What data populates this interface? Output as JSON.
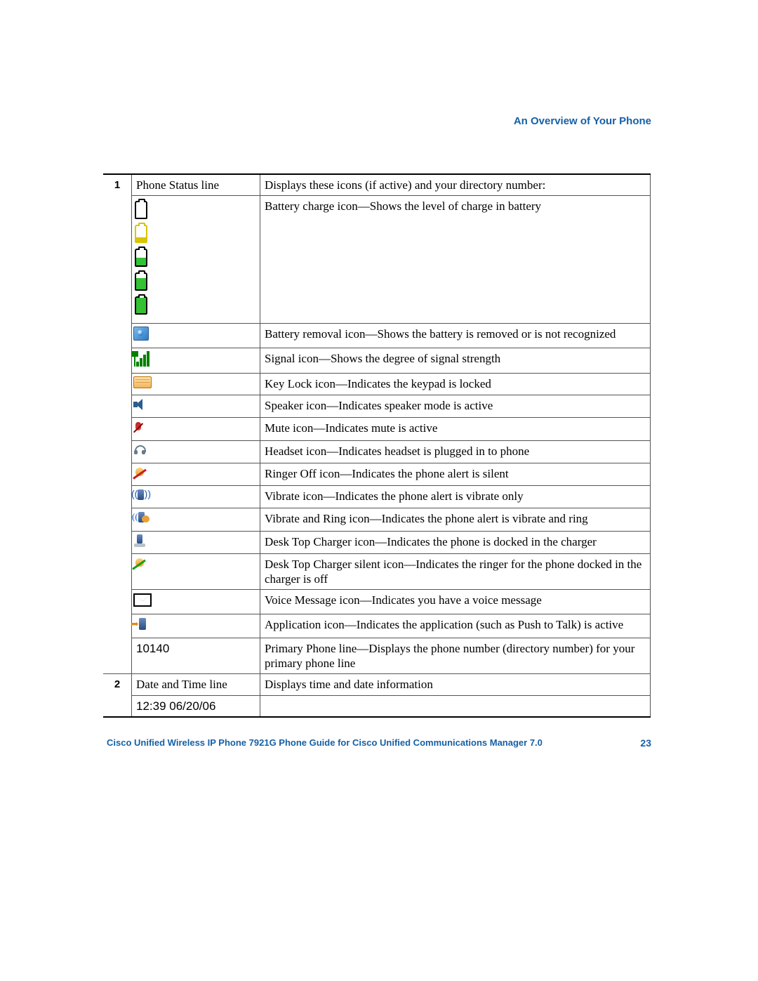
{
  "header": {
    "section_title": "An Overview of Your Phone"
  },
  "table": {
    "row1": {
      "num": "1",
      "label": "Phone Status line",
      "desc_top": "Displays these icons (if active) and your directory number:",
      "battery_desc": "Battery charge icon—Shows the level of charge in battery",
      "battery_removal": "Battery removal icon—Shows the battery is removed or is not recognized",
      "signal": "Signal icon—Shows the degree of signal strength",
      "keylock": "Key Lock icon—Indicates the keypad is locked",
      "speaker": "Speaker icon—Indicates speaker mode is active",
      "mute": "Mute icon—Indicates mute is active",
      "headset": "Headset icon—Indicates headset is plugged in to phone",
      "ringer_off": "Ringer Off icon—Indicates the phone alert is silent",
      "vibrate": "Vibrate icon—Indicates the phone alert is vibrate only",
      "vibrate_ring": "Vibrate and Ring icon—Indicates the phone alert is vibrate and ring",
      "dock": "Desk Top Charger icon—Indicates the phone is docked in the charger",
      "dock_silent": "Desk Top Charger silent icon—Indicates the ringer for the phone docked in the charger is off",
      "voicemail": "Voice Message icon—Indicates you have a voice message",
      "application": "Application icon—Indicates the application (such as Push to Talk) is active",
      "primary_line_value": "10140",
      "primary_line_desc": "Primary Phone line—Displays the phone number (directory number) for your primary phone line"
    },
    "row2": {
      "num": "2",
      "label": "Date and Time line",
      "desc": "Displays time and date information",
      "example": "12:39 06/20/06"
    }
  },
  "footer": {
    "doc_title": "Cisco Unified Wireless IP Phone 7921G Phone Guide for Cisco Unified Communications Manager 7.0",
    "page_number": "23"
  }
}
